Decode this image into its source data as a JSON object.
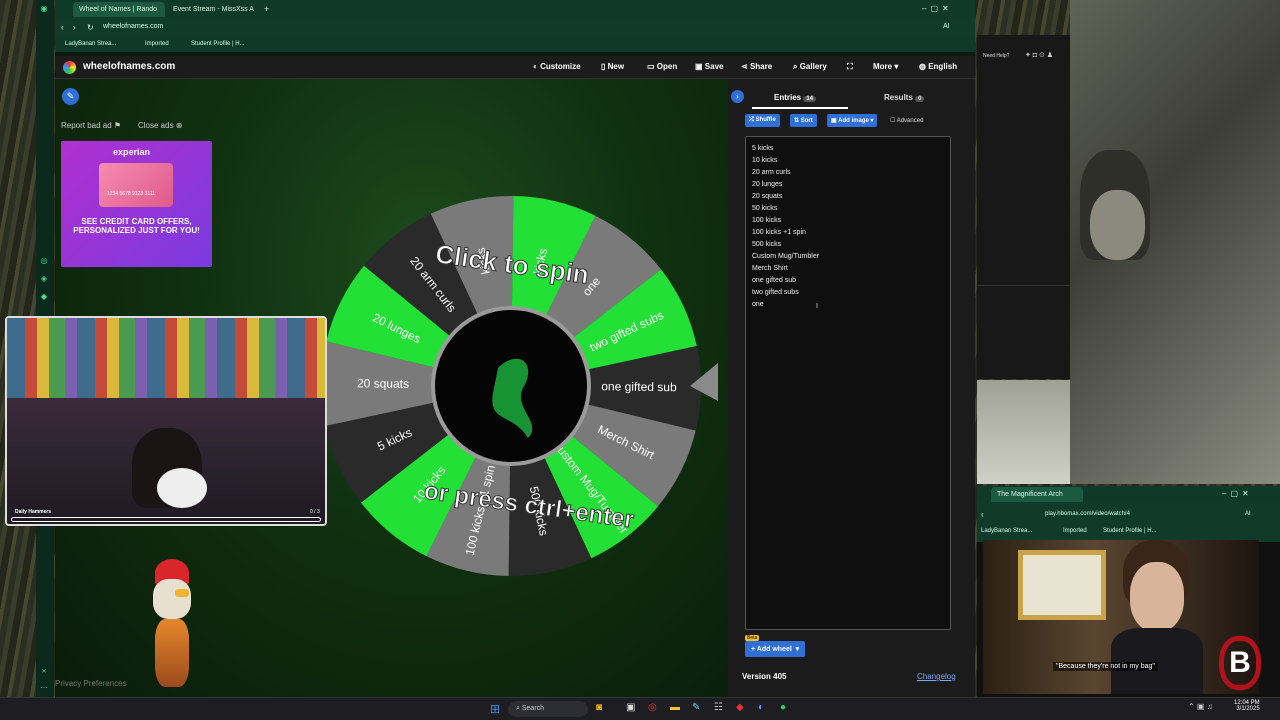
{
  "browser": {
    "tabs": [
      "Wheel of Names | Rando",
      "Event Stream - MissXss A"
    ],
    "url": "wheelofnames.com",
    "bookmarks": [
      "LadyBanan Strea...",
      "Imported",
      "Student Profile | H..."
    ],
    "ai_label": "AI"
  },
  "app": {
    "logo": "wheelofnames.com",
    "nav": {
      "customize": "Customize",
      "new": "New",
      "open": "Open",
      "save": "Save",
      "share": "Share",
      "gallery": "Gallery",
      "more": "More",
      "language": "English"
    },
    "ad": {
      "report": "Report bad ad",
      "close": "Close ads",
      "brand": "experian",
      "card_number": "1234 5678 9123 3111",
      "headline": "SEE CREDIT CARD OFFERS, PERSONALIZED JUST FOR YOU!"
    },
    "wheel": {
      "spin_text": "Click to spin",
      "press_text": "or press ctrl+enter",
      "segments": [
        "kicks",
        "kicks",
        "one",
        "two gifted subs",
        "one gifted sub",
        "Merch Shirt",
        "Custom Mug/Tumbler",
        "500 kicks",
        "100 kicks +1 spin",
        "10 kicks",
        "5 kicks",
        "20 squats",
        "20 lunges",
        "20 arm curls"
      ]
    },
    "panel": {
      "entries_tab": "Entries",
      "entries_count": "14",
      "results_tab": "Results",
      "results_count": "0",
      "shuffle": "Shuffle",
      "sort": "Sort",
      "add_image": "Add image",
      "advanced": "Advanced",
      "entries": [
        "5 kicks",
        "10 kicks",
        "20 arm curls",
        "20 lunges",
        "20 squats",
        "50 kicks",
        "100 kicks",
        "100 kicks +1 spin",
        "500 kicks",
        "Custom Mug/Tumbler",
        "Merch Shirt",
        "one gifted sub",
        "two gifted subs",
        "one"
      ],
      "beta": "Beta",
      "add_wheel": "Add wheel",
      "version": "Version 405",
      "changelog": "Changelog"
    },
    "privacy": "Privacy Preferences"
  },
  "overlay": {
    "daily_label": "Daily Hammers",
    "daily_count": "0 / 3"
  },
  "sidewin": {
    "need_help": "Need Help?"
  },
  "hbo": {
    "tab": "The Magnificent Arch",
    "url": "play.hbomax.com/video/watch/4",
    "bookmarks": [
      "LadyBanan Strea...",
      "Imported",
      "Student Profile | H..."
    ],
    "ai_label": "AI",
    "subtitle": "\"Because they're not in my bag\""
  },
  "taskbar": {
    "search": "Search",
    "time": "12:04 PM",
    "date": "3/1/2025"
  },
  "colors": {
    "accent_green": "#22e036",
    "wheel_gray": "#7a7a7a",
    "wheel_dark": "#2a2a2a",
    "brand_blue": "#2f6fd6"
  }
}
